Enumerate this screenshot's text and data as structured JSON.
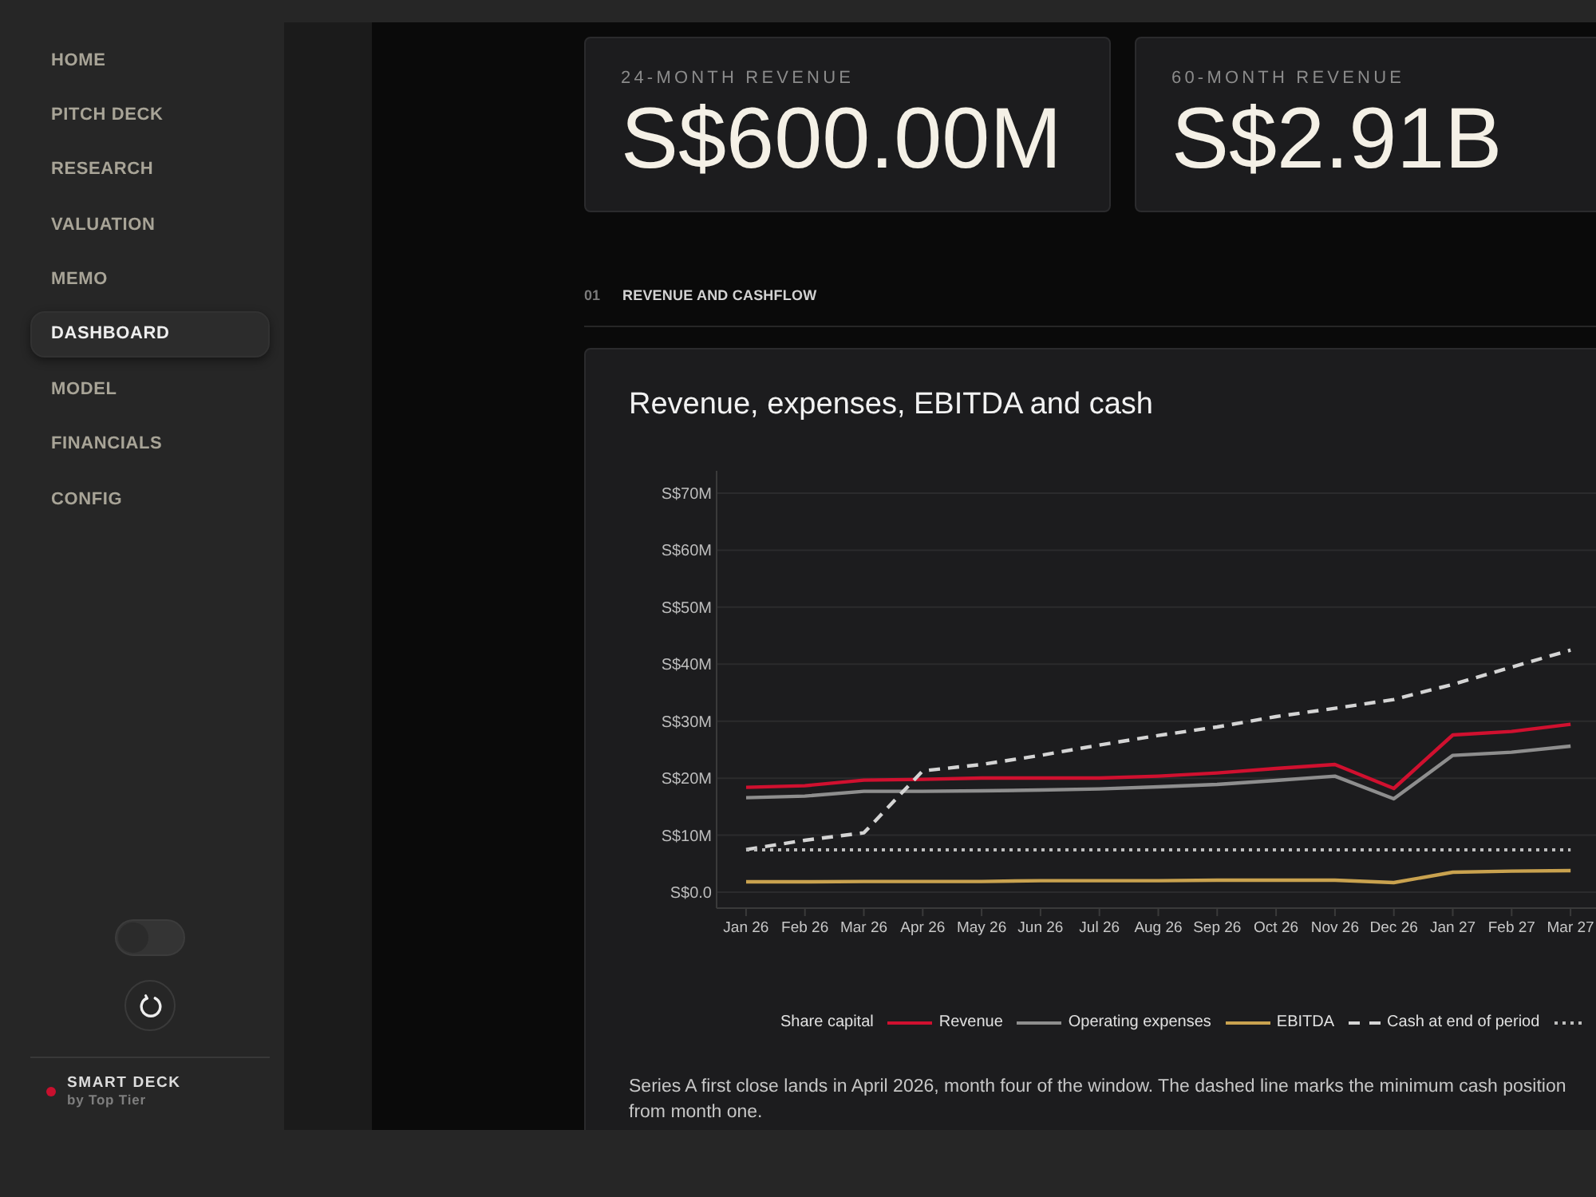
{
  "sidebar": {
    "items": [
      {
        "label": "HOME",
        "selected": false
      },
      {
        "label": "PITCH DECK",
        "selected": false
      },
      {
        "label": "RESEARCH",
        "selected": false
      },
      {
        "label": "VALUATION",
        "selected": false
      },
      {
        "label": "MEMO",
        "selected": false
      },
      {
        "label": "DASHBOARD",
        "selected": true
      },
      {
        "label": "MODEL",
        "selected": false
      },
      {
        "label": "FINANCIALS",
        "selected": false
      },
      {
        "label": "CONFIG",
        "selected": false
      }
    ],
    "theme_toggle": {
      "on": false
    },
    "brand": {
      "name": "SMART DECK",
      "tagline": "by Top Tier"
    }
  },
  "kpi_cards": [
    {
      "label": "24-MONTH REVENUE",
      "value": "S$600.00M"
    },
    {
      "label": "60-MONTH REVENUE",
      "value": "S$2.91B"
    }
  ],
  "section": {
    "number": "01",
    "title": "REVENUE AND CASHFLOW"
  },
  "chart_card": {
    "title": "Revenue, expenses, EBITDA and cash",
    "chart": {
      "y_axis_labels": [
        "S$70M",
        "S$60M",
        "S$50M",
        "S$40M",
        "S$30M",
        "S$20M",
        "S$10M",
        "S$0.0"
      ],
      "x_axis_labels": [
        "Jan 26",
        "Feb 26",
        "Mar 26",
        "Apr 26",
        "May 26",
        "Jun 26",
        "Jul 26",
        "Aug 26",
        "Sep 26",
        "Oct 26",
        "Nov 26",
        "Dec 26",
        "Jan 27",
        "Feb 27",
        "Mar 27"
      ],
      "legend": [
        {
          "name": "Share capital",
          "kind": "plain"
        },
        {
          "name": "Revenue",
          "color": "#d0102f",
          "kind": "solid"
        },
        {
          "name": "Operating expenses",
          "color": "#8e8e8e",
          "kind": "solid"
        },
        {
          "name": "EBITDA",
          "color": "#c9a24f",
          "kind": "solid"
        },
        {
          "name": "Cash at end of period",
          "color": "#d4d4d4",
          "kind": "dashed"
        },
        {
          "color": "#bcbcbc",
          "kind": "dotted"
        }
      ]
    },
    "note": "Series A first close lands in April 2026, month four of the window. The dashed line marks the minimum cash position from month one."
  }
}
